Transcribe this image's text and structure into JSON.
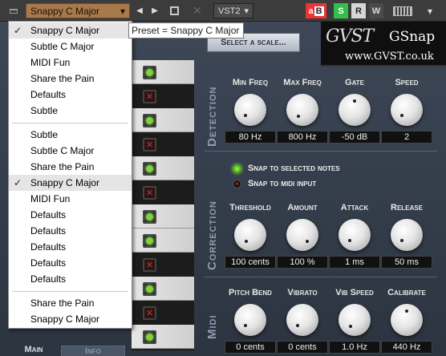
{
  "toolbar": {
    "preset_label": "Snappy C Major",
    "preset_chevron": "▾",
    "prev_icon": "◀",
    "next_icon": "▶",
    "close_icon": "✕",
    "plugin_type": "VST2",
    "plugin_type_chevron": "▾",
    "ab_label": "a",
    "ab_sub": "B",
    "s_label": "S",
    "r_label": "R",
    "w_label": "W",
    "more_icon": "▾"
  },
  "preset_menu": {
    "group1": [
      "Snappy C Major",
      "Subtle C Major",
      "MIDI Fun",
      "Share the Pain",
      "Defaults",
      "Subtle"
    ],
    "group2": [
      "Subtle",
      "Subtle C Major",
      "Share the Pain",
      "Snappy C Major",
      "MIDI Fun",
      "Defaults",
      "Defaults",
      "Defaults",
      "Defaults",
      "Defaults"
    ],
    "group3": [
      "Share the Pain",
      "Snappy C Major"
    ],
    "checkmark": "✓"
  },
  "tooltip": "Preset = Snappy C Major",
  "plugin": {
    "logo_brand": "GVST",
    "logo_name": "GSnap",
    "logo_url": "www.GVST.co.uk",
    "select_scale_label": "Select a scale...",
    "notes": [
      "on",
      "off",
      "on",
      "off",
      "on",
      "off",
      "on",
      "on",
      "off",
      "on",
      "off",
      "on"
    ],
    "off_glyph": "✕",
    "detection": {
      "section_label": "Detection",
      "knobs": [
        {
          "label": "Min Freq",
          "value": "80 Hz"
        },
        {
          "label": "Max Freq",
          "value": "800 Hz"
        },
        {
          "label": "Gate",
          "value": "-50 dB"
        },
        {
          "label": "Speed",
          "value": "2"
        }
      ]
    },
    "correction": {
      "section_label": "Correction",
      "radio_selected": "Snap to selected notes",
      "radio_midi": "Snap to midi input",
      "knobs": [
        {
          "label": "Threshold",
          "value": "100 cents"
        },
        {
          "label": "Amount",
          "value": "100 %"
        },
        {
          "label": "Attack",
          "value": "1 ms"
        },
        {
          "label": "Release",
          "value": "50 ms"
        }
      ]
    },
    "midi": {
      "section_label": "Midi",
      "knobs": [
        {
          "label": "Pitch Bend",
          "value": "0 cents"
        },
        {
          "label": "Vibrato",
          "value": "0 cents"
        },
        {
          "label": "Vib Speed",
          "value": "1.0 Hz"
        },
        {
          "label": "Calibrate",
          "value": "440 Hz"
        }
      ]
    },
    "tab_main": "Main",
    "tab_info": "Info"
  }
}
